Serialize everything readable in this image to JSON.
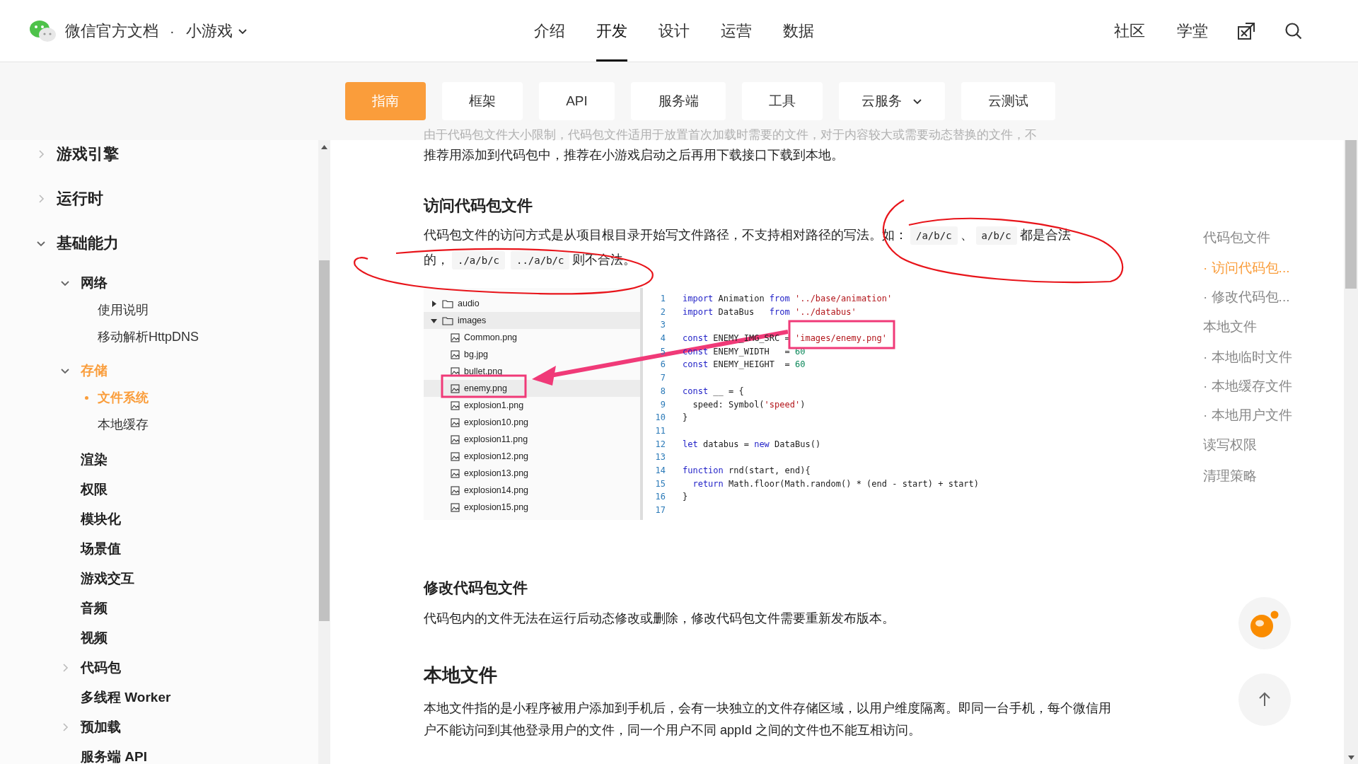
{
  "header": {
    "site_title": "微信官方文档",
    "separator": "·",
    "product": "小游戏",
    "nav": [
      {
        "label": "介绍",
        "selected": false
      },
      {
        "label": "开发",
        "selected": true
      },
      {
        "label": "设计",
        "selected": false
      },
      {
        "label": "运营",
        "selected": false
      },
      {
        "label": "数据",
        "selected": false
      }
    ],
    "links": [
      "社区",
      "学堂"
    ]
  },
  "subnav": [
    {
      "label": "指南",
      "selected": true,
      "kind": "link"
    },
    {
      "label": "框架",
      "selected": false,
      "kind": "link"
    },
    {
      "label": "API",
      "selected": false,
      "kind": "link"
    },
    {
      "label": "服务端",
      "selected": false,
      "kind": "link"
    },
    {
      "label": "工具",
      "selected": false,
      "kind": "link"
    },
    {
      "label": "云服务",
      "selected": false,
      "kind": "menu"
    },
    {
      "label": "云测试",
      "selected": false,
      "kind": "link"
    }
  ],
  "sidebar": {
    "items": [
      {
        "label": "游戏引擎",
        "expanded": false,
        "active": false
      },
      {
        "label": "运行时",
        "expanded": false,
        "active": false
      },
      {
        "label": "基础能力",
        "expanded": true,
        "active": false,
        "children": [
          {
            "label": "网络",
            "expanded": true,
            "active": false,
            "children": [
              {
                "label": "使用说明",
                "active": false
              },
              {
                "label": "移动解析HttpDNS",
                "active": false
              }
            ]
          },
          {
            "label": "存储",
            "expanded": true,
            "active": true,
            "children": [
              {
                "label": "文件系统",
                "active": true
              },
              {
                "label": "本地缓存",
                "active": false
              }
            ]
          },
          {
            "label": "渲染",
            "active": false
          },
          {
            "label": "权限",
            "active": false
          },
          {
            "label": "模块化",
            "active": false
          },
          {
            "label": "场景值",
            "active": false
          },
          {
            "label": "游戏交互",
            "active": false
          },
          {
            "label": "音频",
            "active": false
          },
          {
            "label": "视频",
            "active": false
          },
          {
            "label": "代码包",
            "expanded": false,
            "active": false
          },
          {
            "label": "多线程 Worker",
            "active": false
          },
          {
            "label": "预加载",
            "expanded": false,
            "active": false
          },
          {
            "label": "服务端 API",
            "active": false
          }
        ]
      }
    ]
  },
  "content": {
    "faded_line": "由于代码包文件大小限制，代码包文件适用于放置首次加载时需要的文件，对于内容较大或需要动态替换的文件，不",
    "intro": "推荐用添加到代码包中，推荐在小游戏启动之后再用下载接口下载到本地。",
    "section_1": {
      "heading": "访问代码包文件",
      "paragraph": [
        {
          "kind": "text",
          "text": "代码包文件的访问方式是从项目根目录开始写文件路径，不支持相对路径的写法。如："
        },
        {
          "kind": "code",
          "text": "/a/b/c"
        },
        {
          "kind": "text",
          "text": "、"
        },
        {
          "kind": "code",
          "text": "a/b/c"
        },
        {
          "kind": "text",
          "text": "都是合法的，"
        },
        {
          "kind": "code",
          "text": "./a/b/c"
        },
        {
          "kind": "code",
          "text": "../a/b/c"
        },
        {
          "kind": "text",
          "text": "则不合法。"
        }
      ]
    },
    "screenshot": {
      "files": [
        {
          "name": "audio",
          "kind": "folder",
          "expanded": false,
          "selected": false
        },
        {
          "name": "images",
          "kind": "folder",
          "expanded": true,
          "selected": true
        },
        {
          "name": "Common.png",
          "kind": "file",
          "selected": false
        },
        {
          "name": "bg.jpg",
          "kind": "file",
          "selected": false
        },
        {
          "name": "bullet.png",
          "kind": "file",
          "selected": false
        },
        {
          "name": "enemy.png",
          "kind": "file",
          "selected": true
        },
        {
          "name": "explosion1.png",
          "kind": "file",
          "selected": false
        },
        {
          "name": "explosion10.png",
          "kind": "file",
          "selected": false
        },
        {
          "name": "explosion11.png",
          "kind": "file",
          "selected": false
        },
        {
          "name": "explosion12.png",
          "kind": "file",
          "selected": false
        },
        {
          "name": "explosion13.png",
          "kind": "file",
          "selected": false
        },
        {
          "name": "explosion14.png",
          "kind": "file",
          "selected": false
        },
        {
          "name": "explosion15.png",
          "kind": "file",
          "selected": false
        }
      ],
      "code_lines": [
        {
          "number": "1",
          "tokens": [
            {
              "kind": "keyword",
              "text": "import"
            },
            {
              "kind": "plain",
              "text": " Animation "
            },
            {
              "kind": "keyword",
              "text": "from "
            },
            {
              "kind": "string",
              "text": "'../base/animation'"
            }
          ]
        },
        {
          "number": "2",
          "tokens": [
            {
              "kind": "keyword",
              "text": "import"
            },
            {
              "kind": "plain",
              "text": " DataBus   "
            },
            {
              "kind": "keyword",
              "text": "from "
            },
            {
              "kind": "string",
              "text": "'../databus'"
            }
          ]
        },
        {
          "number": "3"
        },
        {
          "number": "4",
          "tokens": [
            {
              "kind": "keyword",
              "text": "const"
            },
            {
              "kind": "plain",
              "text": " ENEMY_IMG_SRC = "
            },
            {
              "kind": "string",
              "text": "'images/enemy.png'"
            }
          ]
        },
        {
          "number": "5",
          "tokens": [
            {
              "kind": "keyword",
              "text": "const"
            },
            {
              "kind": "plain",
              "text": " ENEMY_WIDTH   = "
            },
            {
              "kind": "number",
              "text": "60"
            }
          ]
        },
        {
          "number": "6",
          "tokens": [
            {
              "kind": "keyword",
              "text": "const"
            },
            {
              "kind": "plain",
              "text": " ENEMY_HEIGHT  = "
            },
            {
              "kind": "number",
              "text": "60"
            }
          ]
        },
        {
          "number": "7"
        },
        {
          "number": "8",
          "tokens": [
            {
              "kind": "keyword",
              "text": "const"
            },
            {
              "kind": "plain",
              "text": " __ = {"
            }
          ]
        },
        {
          "number": "9",
          "tokens": [
            {
              "kind": "plain",
              "text": "  speed: Symbol("
            },
            {
              "kind": "string",
              "text": "'speed'"
            },
            {
              "kind": "plain",
              "text": ")"
            }
          ]
        },
        {
          "number": "10",
          "tokens": [
            {
              "kind": "plain",
              "text": "}"
            }
          ]
        },
        {
          "number": "11"
        },
        {
          "number": "12",
          "tokens": [
            {
              "kind": "keyword",
              "text": "let"
            },
            {
              "kind": "plain",
              "text": " databus = "
            },
            {
              "kind": "keyword",
              "text": "new"
            },
            {
              "kind": "plain",
              "text": " DataBus()"
            }
          ]
        },
        {
          "number": "13"
        },
        {
          "number": "14",
          "tokens": [
            {
              "kind": "keyword",
              "text": "function"
            },
            {
              "kind": "plain",
              "text": " rnd(start, end){"
            }
          ]
        },
        {
          "number": "15",
          "tokens": [
            {
              "kind": "keyword",
              "text": "  return"
            },
            {
              "kind": "plain",
              "text": " Math.floor(Math.random() * (end - start) + start)"
            }
          ]
        },
        {
          "number": "16",
          "tokens": [
            {
              "kind": "plain",
              "text": "}"
            }
          ]
        },
        {
          "number": "17"
        }
      ]
    },
    "section_2": {
      "heading": "修改代码包文件",
      "paragraph": "代码包内的文件无法在运行后动态修改或删除，修改代码包文件需要重新发布版本。"
    },
    "section_3": {
      "heading": "本地文件",
      "paragraph": "本地文件指的是小程序被用户添加到手机后，会有一块独立的文件存储区域，以用户维度隔离。即同一台手机，每个微信用户不能访问到其他登录用户的文件，同一个用户不同 appId 之间的文件也不能互相访问。"
    }
  },
  "toc": [
    {
      "label": "代码包文件",
      "kind": "section",
      "selected": false
    },
    {
      "label": "· 访问代码包...",
      "kind": "sub",
      "selected": true
    },
    {
      "label": "· 修改代码包...",
      "kind": "sub",
      "selected": false
    },
    {
      "label": "本地文件",
      "kind": "section",
      "selected": false
    },
    {
      "label": "· 本地临时文件",
      "kind": "sub",
      "selected": false
    },
    {
      "label": "· 本地缓存文件",
      "kind": "sub",
      "selected": false
    },
    {
      "label": "· 本地用户文件",
      "kind": "sub",
      "selected": false
    },
    {
      "label": "读写权限",
      "kind": "section",
      "selected": false
    },
    {
      "label": "清理策略",
      "kind": "section",
      "selected": false
    }
  ]
}
